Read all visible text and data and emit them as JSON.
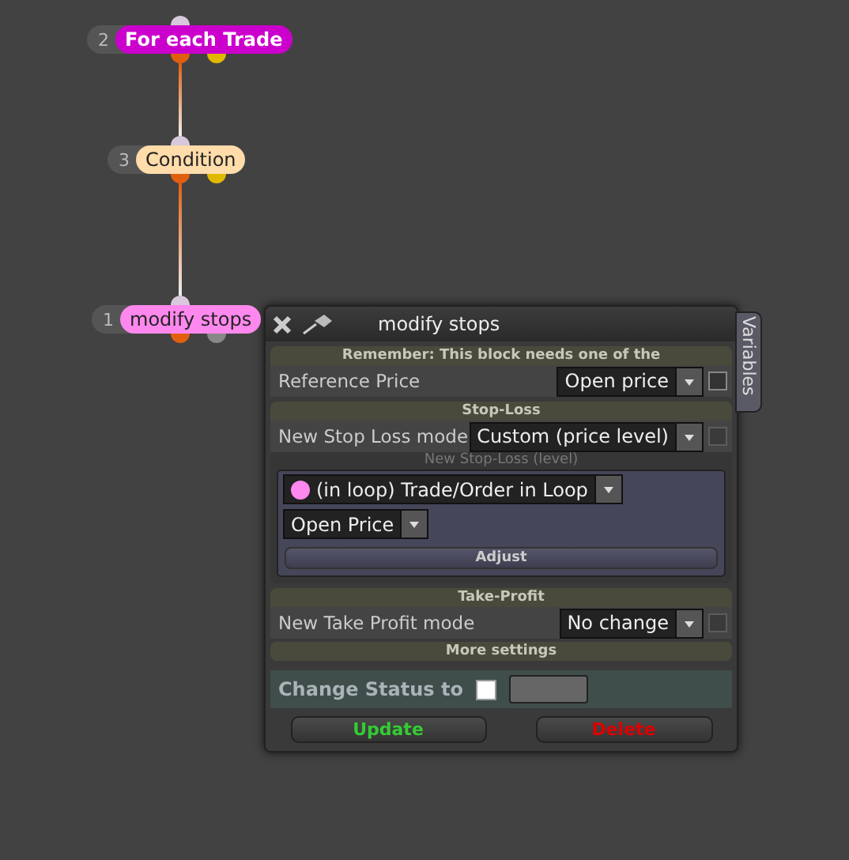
{
  "nodes": [
    {
      "number": "2",
      "label": "For each Trade",
      "color": "#cc00cc",
      "kind": "loop",
      "ports": [
        {
          "color": "#e06010"
        },
        {
          "color": "#e0b800"
        }
      ]
    },
    {
      "number": "3",
      "label": "Condition",
      "color": "#ffdcaa",
      "kind": "condition",
      "ports": [
        {
          "color": "#e06010"
        },
        {
          "color": "#e0b800"
        }
      ]
    },
    {
      "number": "1",
      "label": "modify stops",
      "color": "#ff88ee",
      "kind": "action",
      "ports": [
        {
          "color": "#e06010"
        },
        {
          "color": "#888888"
        }
      ]
    }
  ],
  "panel": {
    "title": "modify stops",
    "side_tab": "Variables",
    "sections": [
      {
        "header": "Remember: This block needs one of the",
        "rows": [
          {
            "label": "Reference Price",
            "value": "Open price",
            "checkbox": {
              "checked": false,
              "disabled": false
            }
          }
        ]
      },
      {
        "header": "Stop-Loss",
        "rows": [
          {
            "label": "New Stop Loss mode",
            "value": "Custom (price level)",
            "checkbox": {
              "checked": false,
              "disabled": true
            }
          }
        ],
        "subgroup": {
          "caption": "New Stop-Loss (level)",
          "source": {
            "value": "(in loop) Trade/Order in Loop",
            "color": "#ff88ee"
          },
          "field": "Open Price",
          "button": "Adjust"
        }
      },
      {
        "header": "Take-Profit",
        "rows": [
          {
            "label": "New Take Profit mode",
            "value": "No change",
            "checkbox": {
              "checked": false,
              "disabled": true
            }
          }
        ]
      }
    ],
    "more": "More settings",
    "status": {
      "label": "Change Status to",
      "checked": false
    },
    "buttons": [
      {
        "label": "Update",
        "kind": "update"
      },
      {
        "label": "Delete",
        "kind": "delete"
      }
    ]
  }
}
